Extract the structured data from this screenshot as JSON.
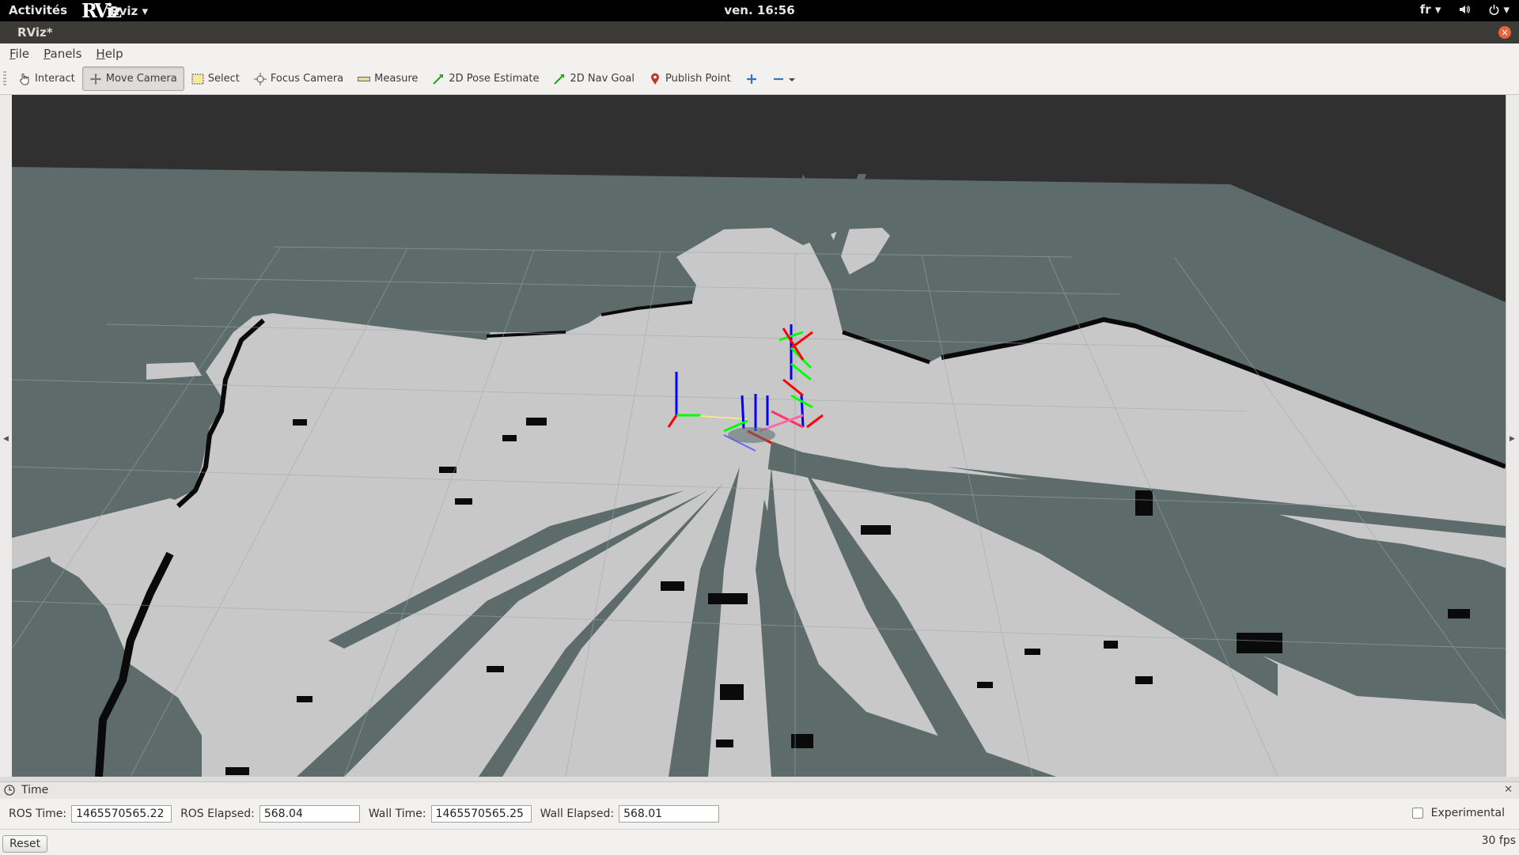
{
  "topbar": {
    "activities": "Activités",
    "app_logo": "RViz",
    "app_name": "Rviz ▾",
    "clock": "ven. 16:56",
    "lang": "fr ▾",
    "volume_icon": "volume-icon",
    "power_icon": "power-icon",
    "power_arrow": "▾"
  },
  "window": {
    "title": "RViz*"
  },
  "menubar": {
    "items": [
      "File",
      "Panels",
      "Help"
    ]
  },
  "toolbar": {
    "interact": "Interact",
    "move_camera": "Move Camera",
    "select": "Select",
    "focus_camera": "Focus Camera",
    "measure": "Measure",
    "pose_estimate": "2D Pose Estimate",
    "nav_goal": "2D Nav Goal",
    "publish_point": "Publish Point",
    "active_tool": "move_camera"
  },
  "time_panel": {
    "title": "Time",
    "ros_time_label": "ROS Time:",
    "ros_time": "1465570565.22",
    "ros_elapsed_label": "ROS Elapsed:",
    "ros_elapsed": "568.04",
    "wall_time_label": "Wall Time:",
    "wall_time": "1465570565.25",
    "wall_elapsed_label": "Wall Elapsed:",
    "wall_elapsed": "568.01",
    "experimental_label": "Experimental",
    "experimental_checked": false
  },
  "statusbar": {
    "reset_label": "Reset",
    "fps": "30 fps"
  },
  "colors": {
    "background": "#303030",
    "unknown": "#5d6b6b",
    "free": "#c8c8c8",
    "occupied": "#000000",
    "grid": "#a0a0a0",
    "axis_x": "#ff0000",
    "axis_y": "#00ff00",
    "axis_z": "#0000ff"
  }
}
